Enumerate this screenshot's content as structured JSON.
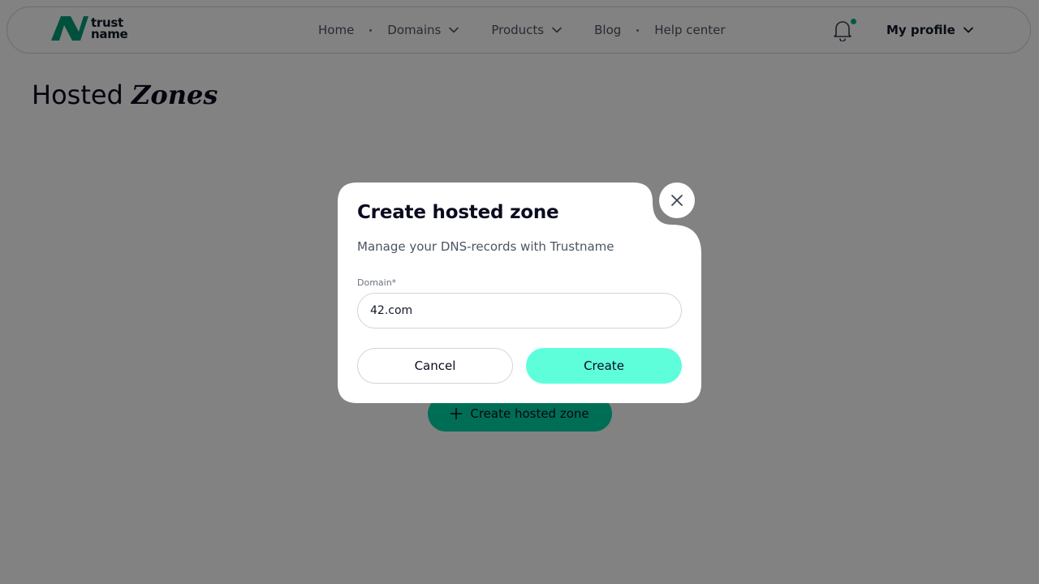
{
  "logo": {
    "line1": "trust",
    "line2": "name",
    "brand_color": "#009d78"
  },
  "nav": {
    "items": [
      {
        "label": "Home"
      },
      {
        "label": "Domains"
      },
      {
        "label": "Products"
      },
      {
        "label": "Blog"
      },
      {
        "label": "Help center"
      }
    ]
  },
  "header": {
    "bell_icon": "bell-icon",
    "notification_dot_color": "#00b386",
    "profile_label": "My profile"
  },
  "page": {
    "title_plain": "Hosted",
    "title_italic": "Zones",
    "create_button_label": "Create hosted zone",
    "accent_color": "#00d8a7"
  },
  "modal": {
    "title": "Create hosted zone",
    "subtitle": "Manage your DNS-records with Trustname",
    "domain_label": "Domain*",
    "domain_value": "42.com",
    "cancel_label": "Cancel",
    "create_label": "Create",
    "create_color": "#5efedb",
    "close_icon": "close-icon"
  }
}
